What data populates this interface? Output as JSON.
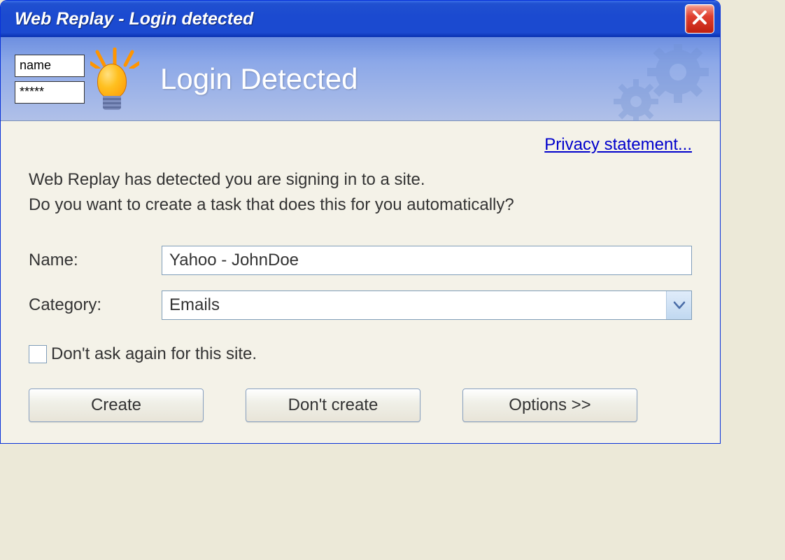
{
  "window": {
    "title": "Web Replay - Login detected"
  },
  "banner": {
    "mini_name": "name",
    "mini_pass": "*****",
    "title": "Login Detected"
  },
  "content": {
    "privacy_link": "Privacy statement...",
    "message_line1": "Web Replay has detected you are signing in to a site.",
    "message_line2": "Do you want to create a task that does this for you automatically?",
    "name_label": "Name:",
    "name_value": "Yahoo - JohnDoe",
    "category_label": "Category:",
    "category_value": "Emails",
    "dont_ask_label": "Don't ask again for this site.",
    "dont_ask_checked": false,
    "create_button": "Create",
    "dont_create_button": "Don't create",
    "options_button": "Options >>"
  }
}
